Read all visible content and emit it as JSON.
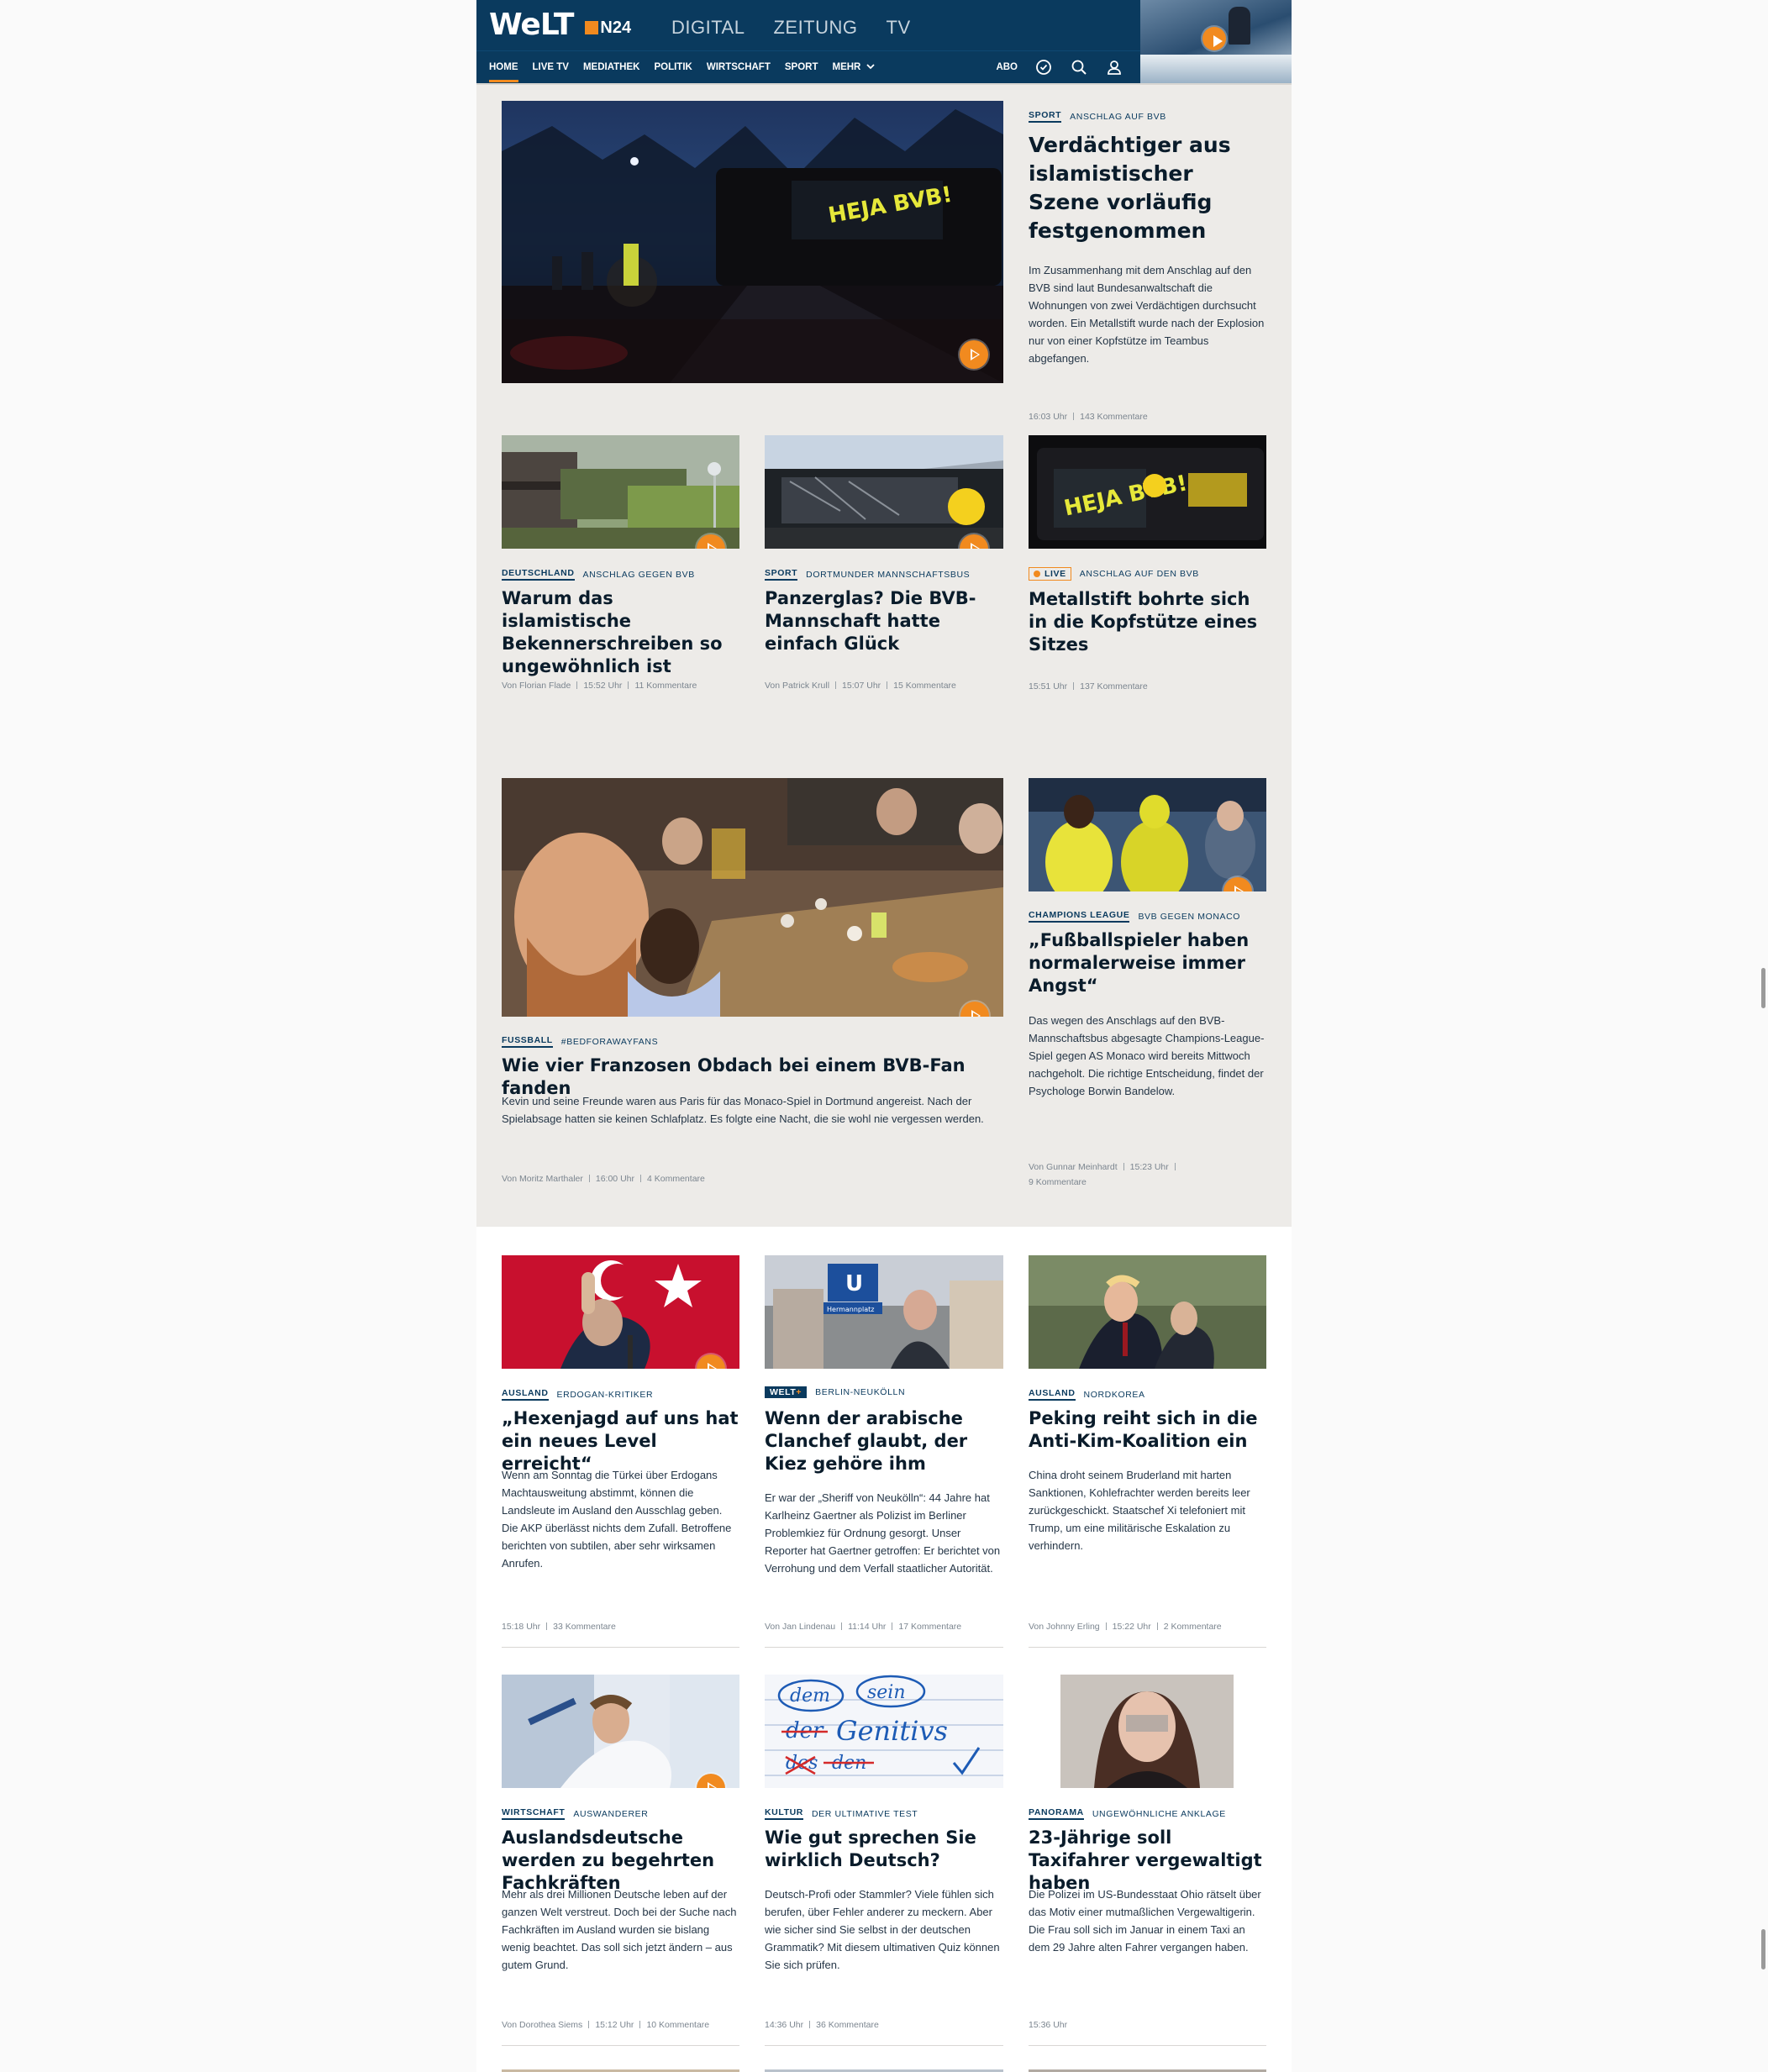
{
  "header": {
    "logo": "WeLT",
    "logo_n24": "N24",
    "top_links": [
      "DIGITAL",
      "ZEITUNG",
      "TV"
    ],
    "nav": [
      "HOME",
      "LIVE TV",
      "MEDIATHEK",
      "POLITIK",
      "WIRTSCHAFT",
      "SPORT",
      "MEHR"
    ],
    "abo": "ABO",
    "accent": "#f18a1f",
    "brand": "#0a3a5e"
  },
  "hero": {
    "rubric": "SPORT",
    "topic": "ANSCHLAG AUF BVB",
    "title": "Verdächtiger aus islamistischer Szene vorläufig festgenommen",
    "teaser": "Im Zusammenhang mit dem Anschlag auf den BVB sind laut Bundesanwaltschaft die Wohnungen von zwei Verdächtigen durchsucht worden. Ein Metallstift wurde nach der Explosion nur von einer Kopfstütze im Teambus abgefangen.",
    "time": "16:03 Uhr",
    "comments": "143 Kommentare"
  },
  "row1": [
    {
      "rubric": "DEUTSCHLAND",
      "topic": "ANSCHLAG GEGEN BVB",
      "title": "Warum das islamistische Bekennerschreiben so ungewöhnlich ist",
      "author": "Von Florian Flade",
      "time": "15:52 Uhr",
      "comments": "11 Kommentare"
    },
    {
      "rubric": "SPORT",
      "topic": "DORTMUNDER MANNSCHAFTSBUS",
      "title": "Panzerglas? Die BVB-Mannschaft hatte einfach Glück",
      "author": "Von Patrick Krull",
      "time": "15:07 Uhr",
      "comments": "15 Kommentare"
    },
    {
      "live": "LIVE",
      "topic": "ANSCHLAG AUF DEN BVB",
      "title": "Metallstift bohrte sich in die Kopfstütze eines Sitzes",
      "time": "15:51 Uhr",
      "comments": "137 Kommentare"
    }
  ],
  "feature": {
    "rubric": "FUSSBALL",
    "topic": "#BEDFORAWAYFANS",
    "title": "Wie vier Franzosen Obdach bei einem BVB-Fan fanden",
    "teaser": "Kevin und seine Freunde waren aus Paris für das Monaco-Spiel in Dortmund angereist. Nach der Spielabsage hatten sie keinen Schlafplatz. Es folgte eine Nacht, die sie wohl nie vergessen werden.",
    "author": "Von Moritz Marthaler",
    "time": "16:00 Uhr",
    "comments": "4 Kommentare"
  },
  "side": {
    "rubric": "CHAMPIONS LEAGUE",
    "topic": "BVB GEGEN MONACO",
    "title": "„Fußballspieler haben normalerweise immer Angst“",
    "teaser": "Das wegen des Anschlags auf den BVB-Mannschaftsbus abgesagte Champions-League-Spiel gegen AS Monaco wird bereits Mittwoch nachgeholt. Die richtige Entscheidung, findet der Psychologe Borwin Bandelow.",
    "author": "Von Gunnar Meinhardt",
    "time": "15:23 Uhr",
    "comments": "9 Kommentare"
  },
  "row3": [
    {
      "rubric": "AUSLAND",
      "topic": "ERDOGAN-KRITIKER",
      "title": "„Hexenjagd auf uns hat ein neues Level erreicht“",
      "teaser": "Wenn am Sonntag die Türkei über Erdogans Machtausweitung abstimmt, können die Landsleute im Ausland den Ausschlag geben. Die AKP überlässt nichts dem Zufall. Betroffene berichten von subtilen, aber sehr wirksamen Anrufen.",
      "time": "15:18 Uhr",
      "comments": "33 Kommentare"
    },
    {
      "weltplus": "WELT",
      "topic": "BERLIN-NEUKÖLLN",
      "title": "Wenn der arabische Clanchef glaubt, der Kiez gehöre ihm",
      "teaser": "Er war der „Sheriff von Neukölln“: 44 Jahre hat Karlheinz Gaertner als Polizist im Berliner Problemkiez für Ordnung gesorgt. Unser Reporter hat Gaertner getroffen: Er berichtet von Verrohung und dem Verfall staatlicher Autorität.",
      "author": "Von Jan Lindenau",
      "time": "11:14 Uhr",
      "comments": "17 Kommentare"
    },
    {
      "rubric": "AUSLAND",
      "topic": "NORDKOREA",
      "title": "Peking reiht sich in die Anti-Kim-Koalition ein",
      "teaser": "China droht seinem Bruderland mit harten Sanktionen, Kohlefrachter werden bereits leer zurückgeschickt. Staatschef Xi telefoniert mit Trump, um eine militärische Eskalation zu verhindern.",
      "author": "Von Johnny Erling",
      "time": "15:22 Uhr",
      "comments": "2 Kommentare"
    }
  ],
  "row4": [
    {
      "rubric": "WIRTSCHAFT",
      "topic": "AUSWANDERER",
      "title": "Auslandsdeutsche werden zu begehrten Fachkräften",
      "teaser": "Mehr als drei Millionen Deutsche leben auf der ganzen Welt verstreut. Doch bei der Suche nach Fachkräften im Ausland wurden sie bislang wenig beachtet. Das soll sich jetzt ändern – aus gutem Grund.",
      "author": "Von Dorothea Siems",
      "time": "15:12 Uhr",
      "comments": "10 Kommentare"
    },
    {
      "rubric": "KULTUR",
      "topic": "DER ULTIMATIVE TEST",
      "title": "Wie gut sprechen Sie wirklich Deutsch?",
      "teaser": "Deutsch-Profi oder Stammler? Viele fühlen sich berufen, über Fehler anderer zu meckern. Aber wie sicher sind Sie selbst in der deutschen Grammatik? Mit diesem ultimativen Quiz können Sie sich prüfen.",
      "time": "14:36 Uhr",
      "comments": "36 Kommentare"
    },
    {
      "rubric": "PANORAMA",
      "topic": "UNGEWÖHNLICHE ANKLAGE",
      "title": "23-Jährige soll Taxifahrer vergewaltigt haben",
      "teaser": "Die Polizei im US-Bundesstaat Ohio rätselt über das Motiv einer mutmaßlichen Vergewaltigerin. Die Frau soll sich im Januar in einem Taxi an dem 29 Jahre alten Fahrer vergangen haben.",
      "time": "15:36 Uhr"
    }
  ],
  "images": {
    "bus_sign": "HEJA BVB!",
    "station_sign": "U",
    "station_name": "Hermannplatz",
    "quiz_words": [
      "dem",
      "sein",
      "der",
      "Genitivs",
      "des",
      "den"
    ]
  }
}
